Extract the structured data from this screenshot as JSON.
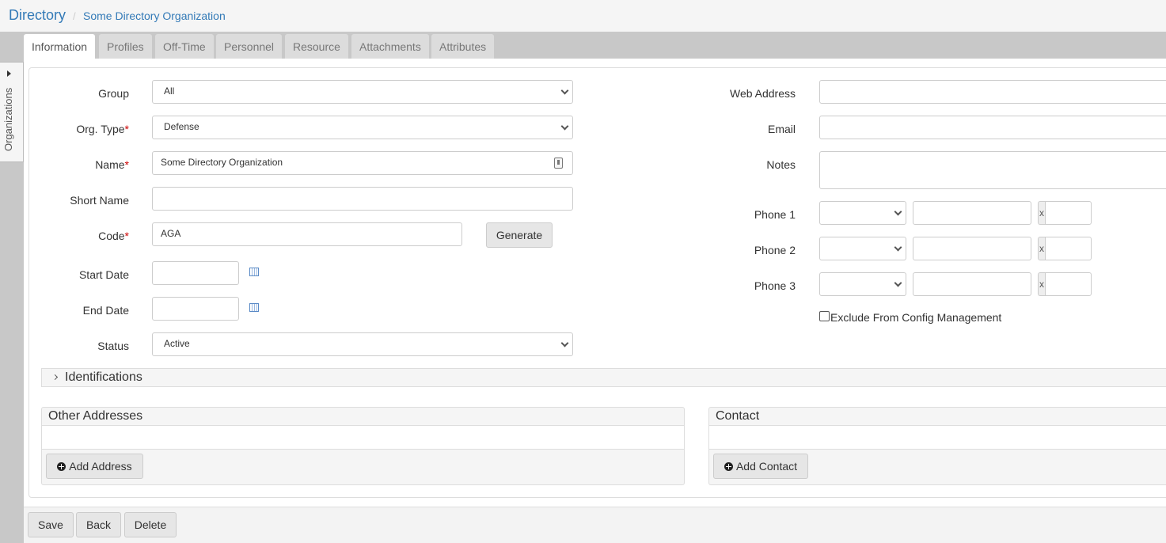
{
  "breadcrumb": {
    "root": "Directory",
    "separator": "/",
    "current": "Some Directory Organization"
  },
  "sidebar": {
    "toggle_label": "Organizations",
    "toggle_icon": "caret-right-icon"
  },
  "tabs": [
    {
      "label": "Information",
      "active": true
    },
    {
      "label": "Profiles",
      "active": false
    },
    {
      "label": "Off-Time",
      "active": false
    },
    {
      "label": "Personnel",
      "active": false
    },
    {
      "label": "Resource",
      "active": false
    },
    {
      "label": "Attachments",
      "active": false
    },
    {
      "label": "Attributes",
      "active": false
    }
  ],
  "form_left": {
    "group": {
      "label": "Group",
      "value": "All"
    },
    "org_type": {
      "label": "Org. Type",
      "required_mark": "*",
      "value": "Defense"
    },
    "name": {
      "label": "Name",
      "required_mark": "*",
      "value": "Some Directory Organization"
    },
    "short_name": {
      "label": "Short Name",
      "value": ""
    },
    "code": {
      "label": "Code",
      "required_mark": "*",
      "value": "AGA",
      "generate_label": "Generate"
    },
    "start_date": {
      "label": "Start Date",
      "value": ""
    },
    "end_date": {
      "label": "End Date",
      "value": ""
    },
    "status": {
      "label": "Status",
      "value": "Active"
    }
  },
  "form_right": {
    "web_address": {
      "label": "Web Address",
      "value": ""
    },
    "email": {
      "label": "Email",
      "value": ""
    },
    "notes": {
      "label": "Notes",
      "value": ""
    },
    "phones": [
      {
        "label": "Phone 1",
        "type": "",
        "number": "",
        "ext_prefix": "x",
        "ext": ""
      },
      {
        "label": "Phone 2",
        "type": "",
        "number": "",
        "ext_prefix": "x",
        "ext": ""
      },
      {
        "label": "Phone 3",
        "type": "",
        "number": "",
        "ext_prefix": "x",
        "ext": ""
      }
    ],
    "exclude_config": {
      "label": "Exclude From Config Management",
      "checked": false
    }
  },
  "identifications": {
    "label": "Identifications",
    "expanded": false
  },
  "other_addresses": {
    "title": "Other Addresses",
    "add_label": "Add Address"
  },
  "contact": {
    "title": "Contact",
    "add_label": "Add Contact"
  },
  "footer": {
    "save_label": "Save",
    "back_label": "Back",
    "delete_label": "Delete"
  }
}
